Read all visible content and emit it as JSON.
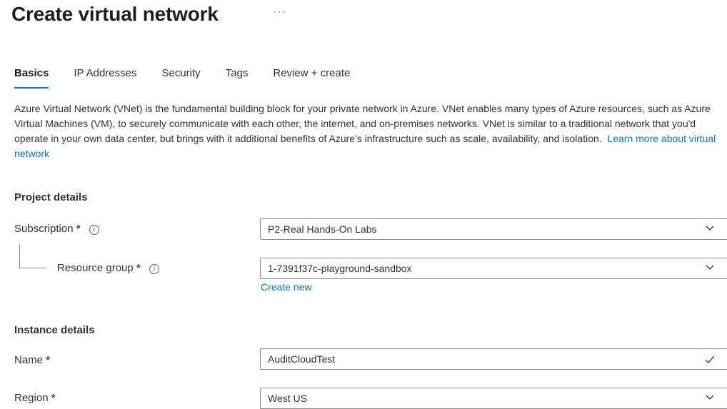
{
  "header": {
    "title": "Create virtual network",
    "more_label": "···"
  },
  "tabs": [
    {
      "label": "Basics",
      "active": true
    },
    {
      "label": "IP Addresses",
      "active": false
    },
    {
      "label": "Security",
      "active": false
    },
    {
      "label": "Tags",
      "active": false
    },
    {
      "label": "Review + create",
      "active": false
    }
  ],
  "intro": {
    "text": "Azure Virtual Network (VNet) is the fundamental building block for your private network in Azure. VNet enables many types of Azure resources, such as Azure Virtual Machines (VM), to securely communicate with each other, the internet, and on-premises networks. VNet is similar to a traditional network that you'd operate in your own data center, but brings with it additional benefits of Azure's infrastructure such as scale, availability, and isolation.",
    "link": "Learn more about virtual network"
  },
  "project_details": {
    "title": "Project details",
    "subscription": {
      "label": "Subscription",
      "required": "*",
      "info_icon": "info-icon",
      "value": "P2-Real Hands-On Labs"
    },
    "resource_group": {
      "label": "Resource group",
      "required": "*",
      "info_icon": "info-icon",
      "value": "1-7391f37c-playground-sandbox",
      "create_new": "Create new"
    }
  },
  "instance_details": {
    "title": "Instance details",
    "name": {
      "label": "Name",
      "required": "*",
      "value": "AuditCloudTest",
      "valid_icon": "checkmark-icon"
    },
    "region": {
      "label": "Region",
      "required": "*",
      "value": "West US"
    }
  },
  "colors": {
    "accent": "#0078d4",
    "required": "#a4262c",
    "valid": "#107c10",
    "border": "#8a8886"
  }
}
